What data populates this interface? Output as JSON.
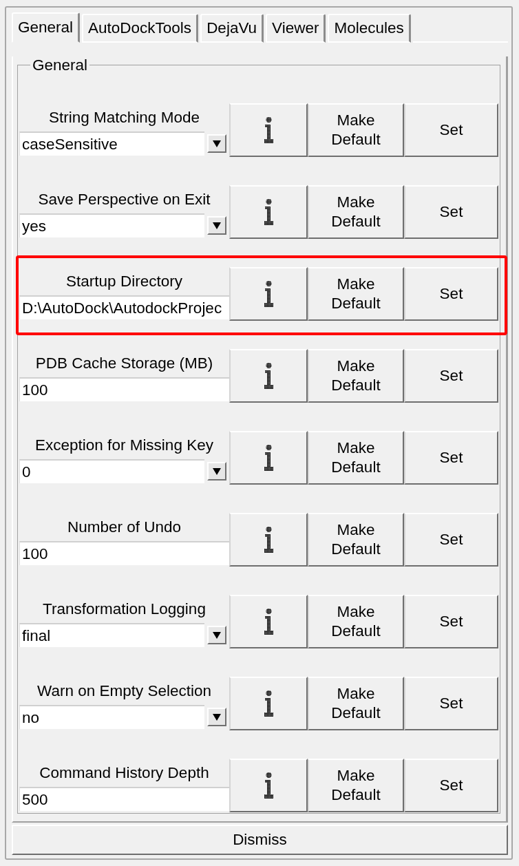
{
  "tabs": [
    {
      "label": "General",
      "selected": true
    },
    {
      "label": "AutoDockTools",
      "selected": false
    },
    {
      "label": "DejaVu",
      "selected": false
    },
    {
      "label": "Viewer",
      "selected": false
    },
    {
      "label": "Molecules",
      "selected": false
    }
  ],
  "group": {
    "title": "General"
  },
  "settings": [
    {
      "label": "String Matching Mode",
      "kind": "combobox",
      "value": "caseSensitive",
      "highlighted": false,
      "make_default": "Make Default",
      "set": "Set"
    },
    {
      "label": "Save Perspective on Exit",
      "kind": "combobox",
      "value": "yes",
      "highlighted": false,
      "make_default": "Make Default",
      "set": "Set"
    },
    {
      "label": "Startup Directory",
      "kind": "entry",
      "value": "D:\\AutoDock\\AutodockProjec",
      "highlighted": true,
      "make_default": "Make Default",
      "set": "Set"
    },
    {
      "label": "PDB Cache Storage (MB)",
      "kind": "entry",
      "value": "100",
      "highlighted": false,
      "make_default": "Make Default",
      "set": "Set"
    },
    {
      "label": "Exception for Missing Key",
      "kind": "combobox",
      "value": "0",
      "highlighted": false,
      "make_default": "Make Default",
      "set": "Set"
    },
    {
      "label": "Number of Undo",
      "kind": "entry",
      "value": "100",
      "highlighted": false,
      "make_default": "Make Default",
      "set": "Set"
    },
    {
      "label": "Transformation Logging",
      "kind": "combobox",
      "value": "final",
      "highlighted": false,
      "make_default": "Make Default",
      "set": "Set"
    },
    {
      "label": "Warn on Empty Selection",
      "kind": "combobox",
      "value": "no",
      "highlighted": false,
      "make_default": "Make Default",
      "set": "Set"
    },
    {
      "label": "Command History Depth",
      "kind": "entry",
      "value": "500",
      "highlighted": false,
      "make_default": "Make Default",
      "set": "Set"
    }
  ],
  "dismiss": "Dismiss"
}
